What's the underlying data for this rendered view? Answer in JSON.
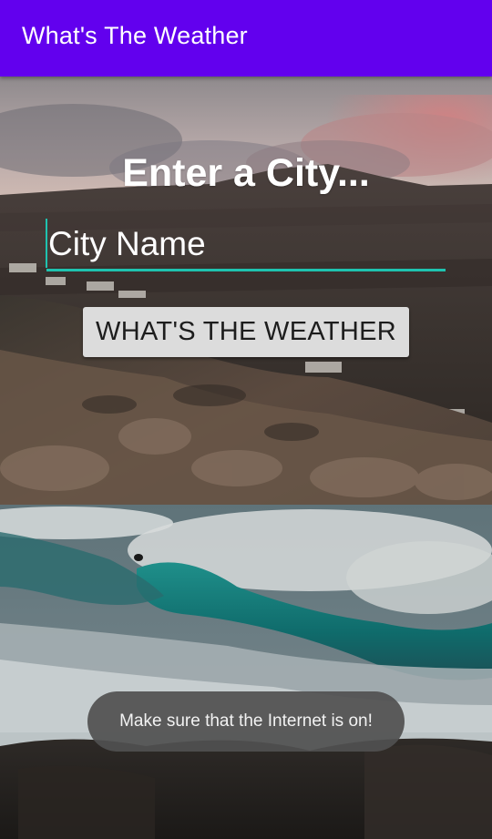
{
  "app_bar": {
    "title": "What's The Weather",
    "color": "#6200EE"
  },
  "main": {
    "heading": "Enter a City...",
    "city_input": {
      "value": "",
      "placeholder": "City Name",
      "underline_color": "#1FC3B0"
    },
    "weather_button": {
      "label": "WHAT'S THE WEATHER"
    }
  },
  "background": {
    "description_icon": "coastal-wave-photo"
  },
  "toast": {
    "message": "Make sure that the Internet is on!"
  }
}
